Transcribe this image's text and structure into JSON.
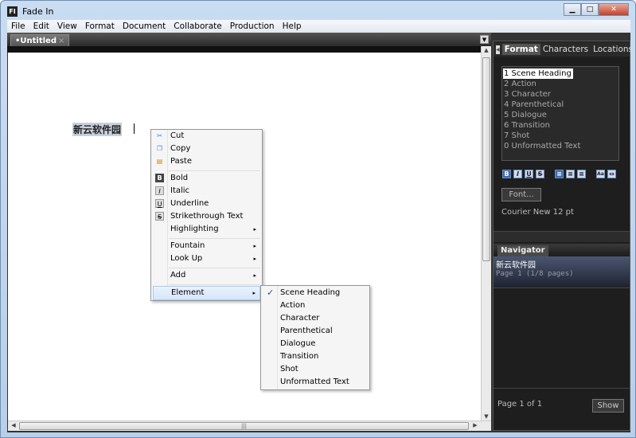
{
  "window": {
    "title": "Fade In",
    "logo": "FI",
    "controls": [
      "minimize",
      "maximize",
      "close"
    ]
  },
  "menu": [
    "File",
    "Edit",
    "View",
    "Format",
    "Document",
    "Collaborate",
    "Production",
    "Help"
  ],
  "doc_tab": {
    "label": "•Untitled",
    "close": "×"
  },
  "document": {
    "text": "新云软件园"
  },
  "panel": {
    "tabs": [
      "Format",
      "Characters",
      "Locations"
    ],
    "active_tab": "Format",
    "elements": [
      "1 Scene Heading",
      "2 Action",
      "3 Character",
      "4 Parenthetical",
      "5 Dialogue",
      "6 Transition",
      "7 Shot",
      "0 Unformatted Text"
    ],
    "format_buttons": [
      {
        "icon": "bold-icon",
        "glyph": "B"
      },
      {
        "icon": "italic-icon",
        "glyph": "I"
      },
      {
        "icon": "underline-icon",
        "glyph": "U"
      },
      {
        "icon": "strikethrough-icon",
        "glyph": "S"
      },
      {
        "icon": "align-left-icon",
        "glyph": "≡"
      },
      {
        "icon": "align-center-icon",
        "glyph": "≡"
      },
      {
        "icon": "align-right-icon",
        "glyph": "≡"
      },
      {
        "icon": "font-case-icon",
        "glyph": "Aa"
      },
      {
        "icon": "link-icon",
        "glyph": "⇔"
      }
    ],
    "font_button": "Font...",
    "font_info": "Courier New 12 pt"
  },
  "navigator": {
    "tab": "Navigator",
    "item_title": "新云软件园",
    "item_sub": "Page 1 (1/8 pages)",
    "page_info": "Page 1 of 1",
    "show_button": "Show"
  },
  "context_menu": {
    "items": [
      {
        "label": "Cut",
        "icon": "scissors-icon",
        "glyph": "✂"
      },
      {
        "label": "Copy",
        "icon": "copy-icon",
        "glyph": "❐"
      },
      {
        "label": "Paste",
        "icon": "paste-icon",
        "glyph": "▤"
      },
      {
        "label": "Bold",
        "icon": "bold-icon",
        "glyph": "B"
      },
      {
        "label": "Italic",
        "icon": "italic-icon",
        "glyph": "I"
      },
      {
        "label": "Underline",
        "icon": "underline-icon",
        "glyph": "U"
      },
      {
        "label": "Strikethrough Text",
        "icon": "strikethrough-icon",
        "glyph": "S"
      },
      {
        "label": "Highlighting",
        "submenu": true
      },
      {
        "label": "Fountain",
        "submenu": true
      },
      {
        "label": "Look Up",
        "submenu": true
      },
      {
        "label": "Add",
        "submenu": true
      },
      {
        "label": "Element",
        "submenu": true
      }
    ],
    "submenu_arrow": "▸",
    "element_submenu": [
      "Scene Heading",
      "Action",
      "Character",
      "Parenthetical",
      "Dialogue",
      "Transition",
      "Shot",
      "Unformatted Text"
    ],
    "checked": "Scene Heading",
    "check_glyph": "✓"
  }
}
